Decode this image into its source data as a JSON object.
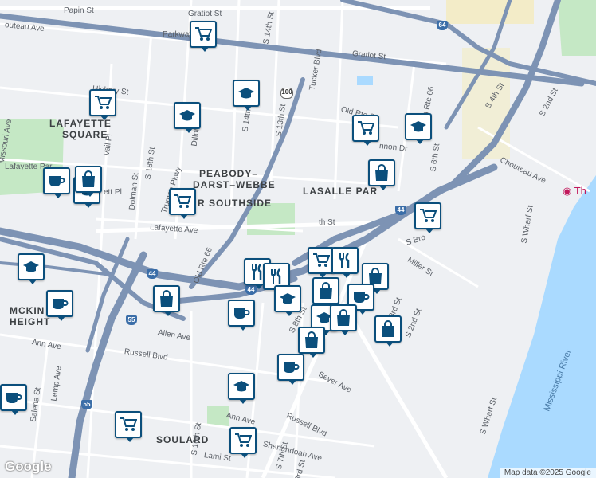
{
  "map": {
    "attribution": "Map data ©2025 Google",
    "logo": "Google",
    "colors": {
      "water": "#aadaff",
      "park": "#c5e8c5",
      "highway": "#7d93b4",
      "road": "#ffffff",
      "land": "#eef0f3",
      "pin_border": "#0b4f7c"
    }
  },
  "neighborhoods": {
    "lafayette_1": "LAFAYETTE",
    "lafayette_2": "SQUARE",
    "peabody_1": "PEABODY–",
    "peabody_2": "DARST–WEBBE",
    "southside": "R SOUTHSIDE",
    "lasalle": "LASALLE PAR",
    "mckinley_1": "MCKIN",
    "mckinley_2": "HEIGHT",
    "soulard": "SOULARD"
  },
  "streets": {
    "papin": "Papin St",
    "chouteau_w": "outeau Ave",
    "gratiot_1": "Gratiot St",
    "gratiot_2": "Gratiot St",
    "s14th": "S 14th St",
    "parkway": "Parkway",
    "tucker": "Tucker Blvd",
    "hickory": "Hickory St",
    "s13th": "S 13th St",
    "s14th_b": "S 14th",
    "oldrte66_top": "Old Rte 66",
    "oldrte66_mid": "Old Rte 66",
    "oldrte66_right": "Old Rte 66",
    "dillon": "Dillon Dr",
    "vail": "Vail Pl",
    "s18th": "S 18th St",
    "dolman": "Dolman St",
    "truman": "Truman Pkwy",
    "missouri": "Missouri Ave",
    "lafayette_park": "Lafayette Par",
    "mcnair": "ett Pl",
    "lafayette_ave": "Lafayette Ave",
    "s4th": "S 4th St",
    "s2nd": "S 2nd St",
    "s6th": "S 6th St",
    "chouteau_e": "Chouteau Ave",
    "gannon": "nnon Dr",
    "wharf_1": "S Wharf St",
    "wharf_2": "S Wharf St",
    "miller": "Miller St",
    "sbroadway": "S Bro",
    "sbroadway2": "S Broadway",
    "s8th": "S 8th St",
    "s3rd": "S 3rd St",
    "s2nd_b": "S 2nd St",
    "allen": "Allen Ave",
    "ann_w": "Ann Ave",
    "ann_e": "Ann Ave",
    "russell_w": "Russell Blvd",
    "russell_e": "Russell Blvd",
    "seyer": "Seyer Ave",
    "lemp": "Lemp Ave",
    "salena": "Salena St",
    "s10th": "S 10th St",
    "s7th": "S 7th St",
    "shenandoah": "Shenandoah Ave",
    "lami": "Lami St",
    "s3rd_b": "3rd St",
    "mississippi": "Mississippi River",
    "the": "Th",
    "ninth": "th St"
  },
  "shields": {
    "i64_top": "64",
    "rte100": "100",
    "i44_right": "44",
    "i44_left": "44",
    "i55_mid": "55",
    "i55_bottom": "55",
    "i44_center": "44"
  },
  "pins": [
    {
      "name": "grocery-pin",
      "icon": "shopping-cart-icon"
    },
    {
      "name": "grocery-pin",
      "icon": "shopping-cart-icon"
    },
    {
      "name": "school-pin",
      "icon": "graduation-cap-icon"
    },
    {
      "name": "school-pin",
      "icon": "graduation-cap-icon"
    },
    {
      "name": "grocery-pin",
      "icon": "shopping-cart-icon"
    },
    {
      "name": "school-pin",
      "icon": "graduation-cap-icon"
    },
    {
      "name": "shopping-pin",
      "icon": "shopping-bag-icon"
    },
    {
      "name": "cafe-pin",
      "icon": "coffee-cup-icon"
    },
    {
      "name": "school-pin",
      "icon": "graduation-cap-icon"
    },
    {
      "name": "grocery-pin",
      "icon": "shopping-cart-icon"
    },
    {
      "name": "grocery-pin",
      "icon": "shopping-cart-icon"
    },
    {
      "name": "school-pin",
      "icon": "graduation-cap-icon"
    },
    {
      "name": "cafe-pin",
      "icon": "coffee-cup-icon"
    },
    {
      "name": "shopping-pin",
      "icon": "shopping-bag-icon"
    },
    {
      "name": "cafe-pin",
      "icon": "coffee-cup-icon"
    },
    {
      "name": "restaurant-pin",
      "icon": "fork-knife-icon"
    },
    {
      "name": "restaurant-pin",
      "icon": "fork-knife-icon"
    },
    {
      "name": "grocery-pin",
      "icon": "shopping-cart-icon"
    },
    {
      "name": "restaurant-pin",
      "icon": "fork-knife-icon"
    },
    {
      "name": "shopping-pin",
      "icon": "shopping-bag-icon"
    },
    {
      "name": "shopping-pin",
      "icon": "shopping-bag-icon"
    },
    {
      "name": "school-pin",
      "icon": "graduation-cap-icon"
    },
    {
      "name": "cafe-pin",
      "icon": "coffee-cup-icon"
    },
    {
      "name": "school-pin",
      "icon": "graduation-cap-icon"
    },
    {
      "name": "shopping-pin",
      "icon": "shopping-bag-icon"
    },
    {
      "name": "shopping-pin",
      "icon": "shopping-bag-icon"
    },
    {
      "name": "shopping-pin",
      "icon": "shopping-bag-icon"
    },
    {
      "name": "cafe-pin",
      "icon": "coffee-cup-icon"
    },
    {
      "name": "school-pin",
      "icon": "graduation-cap-icon"
    },
    {
      "name": "cafe-pin",
      "icon": "coffee-cup-icon"
    },
    {
      "name": "grocery-pin",
      "icon": "shopping-cart-icon"
    },
    {
      "name": "grocery-pin",
      "icon": "shopping-cart-icon"
    },
    {
      "name": "shopping-pin",
      "icon": "shopping-bag-icon"
    }
  ]
}
